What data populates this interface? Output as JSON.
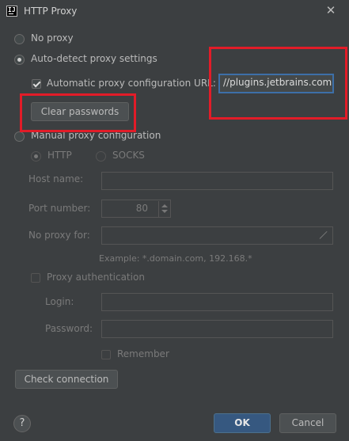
{
  "window": {
    "title": "HTTP Proxy"
  },
  "options": {
    "no_proxy": "No proxy",
    "auto_detect": "Auto-detect proxy settings",
    "auto_config_url_label": "Automatic proxy configuration URL:",
    "auto_config_url_value": "//plugins.jetbrains.com",
    "clear_passwords": "Clear passwords",
    "manual": "Manual proxy configuration"
  },
  "manual": {
    "http": "HTTP",
    "socks": "SOCKS",
    "host_name_label": "Host name:",
    "port_number_label": "Port number:",
    "port_value": "80",
    "no_proxy_for_label": "No proxy for:",
    "example": "Example: *.domain.com, 192.168.*",
    "proxy_auth": "Proxy authentication",
    "login_label": "Login:",
    "password_label": "Password:",
    "remember": "Remember"
  },
  "buttons": {
    "check_connection": "Check connection",
    "help": "?",
    "ok": "OK",
    "cancel": "Cancel"
  },
  "colors": {
    "background": "#3c3f41",
    "highlight_red": "#e21c28",
    "ok_blue": "#365880",
    "focus_blue": "#3d6fa8"
  }
}
